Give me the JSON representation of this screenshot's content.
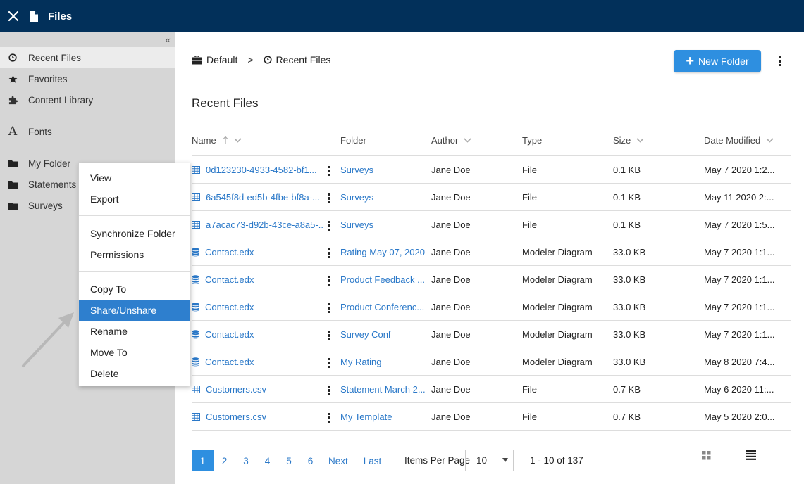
{
  "topbar": {
    "title": "Files"
  },
  "sidebar": {
    "collapse_glyph": "«",
    "items": [
      {
        "label": "Recent Files",
        "icon": "clock-icon"
      },
      {
        "label": "Favorites",
        "icon": "star-icon"
      },
      {
        "label": "Content Library",
        "icon": "puzzle-icon"
      },
      {
        "label": "Fonts",
        "icon": "font-icon"
      },
      {
        "label": "My Folder",
        "icon": "folder-icon"
      },
      {
        "label": "Statements",
        "icon": "folder-icon"
      },
      {
        "label": "Surveys",
        "icon": "folder-icon"
      }
    ]
  },
  "breadcrumb": {
    "root": "Default",
    "separator": ">",
    "current": "Recent Files"
  },
  "toolbar": {
    "new_folder_label": "New Folder"
  },
  "page_title": "Recent Files",
  "table": {
    "columns": {
      "name": "Name",
      "folder": "Folder",
      "author": "Author",
      "type": "Type",
      "size": "Size",
      "date": "Date Modified"
    },
    "rows": [
      {
        "name": "0d123230-4933-4582-bf1...",
        "icon": "grid-file-icon",
        "folder": "Surveys",
        "author": "Jane Doe",
        "type": "File",
        "size": "0.1 KB",
        "date": "May 7 2020 1:2..."
      },
      {
        "name": "6a545f8d-ed5b-4fbe-bf8a-...",
        "icon": "grid-file-icon",
        "folder": "Surveys",
        "author": "Jane Doe",
        "type": "File",
        "size": "0.1 KB",
        "date": "May 11 2020 2:..."
      },
      {
        "name": "a7acac73-d92b-43ce-a8a5-...",
        "icon": "grid-file-icon",
        "folder": "Surveys",
        "author": "Jane Doe",
        "type": "File",
        "size": "0.1 KB",
        "date": "May 7 2020 1:5..."
      },
      {
        "name": "Contact.edx",
        "icon": "database-icon",
        "folder": "Rating May 07, 2020",
        "author": "Jane Doe",
        "type": "Modeler Diagram",
        "size": "33.0 KB",
        "date": "May 7 2020 1:1..."
      },
      {
        "name": "Contact.edx",
        "icon": "database-icon",
        "folder": "Product Feedback ...",
        "author": "Jane Doe",
        "type": "Modeler Diagram",
        "size": "33.0 KB",
        "date": "May 7 2020 1:1..."
      },
      {
        "name": "Contact.edx",
        "icon": "database-icon",
        "folder": "Product Conferenc...",
        "author": "Jane Doe",
        "type": "Modeler Diagram",
        "size": "33.0 KB",
        "date": "May 7 2020 1:1..."
      },
      {
        "name": "Contact.edx",
        "icon": "database-icon",
        "folder": "Survey Conf",
        "author": "Jane Doe",
        "type": "Modeler Diagram",
        "size": "33.0 KB",
        "date": "May 7 2020 1:1..."
      },
      {
        "name": "Contact.edx",
        "icon": "database-icon",
        "folder": "My Rating",
        "author": "Jane Doe",
        "type": "Modeler Diagram",
        "size": "33.0 KB",
        "date": "May 8 2020 7:4..."
      },
      {
        "name": "Customers.csv",
        "icon": "grid-file-icon",
        "folder": "Statement March 2...",
        "author": "Jane Doe",
        "type": "File",
        "size": "0.7 KB",
        "date": "May 6 2020 11:..."
      },
      {
        "name": "Customers.csv",
        "icon": "grid-file-icon",
        "folder": "My Template",
        "author": "Jane Doe",
        "type": "File",
        "size": "0.7 KB",
        "date": "May 5 2020 2:0..."
      }
    ]
  },
  "pagination": {
    "pages": [
      "1",
      "2",
      "3",
      "4",
      "5",
      "6"
    ],
    "current": "1",
    "next": "Next",
    "last": "Last",
    "items_per_page_label": "Items Per Page",
    "items_per_page_value": "10",
    "range": "1 - 10 of 137"
  },
  "context_menu": {
    "groups": [
      [
        "View",
        "Export"
      ],
      [
        "Synchronize Folder",
        "Permissions"
      ],
      [
        "Copy To",
        "Share/Unshare",
        "Rename",
        "Move To",
        "Delete"
      ]
    ],
    "highlighted": "Share/Unshare"
  },
  "colors": {
    "topbar": "#02305a",
    "accent": "#2e8fe0",
    "link": "#2a78c8",
    "sidebar": "#d6d6d6"
  }
}
